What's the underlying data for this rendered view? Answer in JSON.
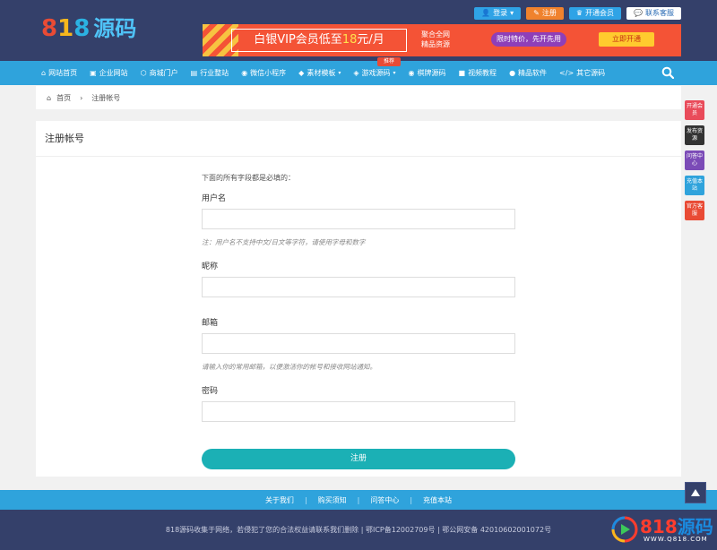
{
  "header": {
    "logo": {
      "digit1": "8",
      "digit2": "1",
      "digit3": "8",
      "text": "源码"
    },
    "actions": {
      "login": "登录",
      "register": "注册",
      "vip": "开通会员",
      "service": "联系客服"
    },
    "banner": {
      "main_pre": "白银VIP会员低至",
      "main_hl": "18",
      "main_post": "元/月",
      "sub1": "聚合全网",
      "sub2": "精品资源",
      "pill": "限时特价，先开先用",
      "open": "立即开通"
    }
  },
  "nav": {
    "items": [
      {
        "label": "网站首页",
        "icon": "home-icon",
        "glyph": "⌂"
      },
      {
        "label": "企业网站",
        "icon": "building-icon",
        "glyph": "▣"
      },
      {
        "label": "商城门户",
        "icon": "shop-icon",
        "glyph": "⬡"
      },
      {
        "label": "行业整站",
        "icon": "grid-icon",
        "glyph": "▤"
      },
      {
        "label": "微信小程序",
        "icon": "wechat-icon",
        "glyph": "◉"
      },
      {
        "label": "素材模板",
        "icon": "tag-icon",
        "glyph": "◆",
        "caret": true
      },
      {
        "label": "游戏源码",
        "icon": "diamond-icon",
        "glyph": "◈",
        "caret": true
      },
      {
        "label": "棋牌源码",
        "icon": "chess-icon",
        "glyph": "◉"
      },
      {
        "label": "视频教程",
        "icon": "video-icon",
        "glyph": "■"
      },
      {
        "label": "精品软件",
        "icon": "star-icon",
        "glyph": "●"
      },
      {
        "label": "其它源码",
        "icon": "code-icon",
        "glyph": "</>"
      }
    ],
    "recommend_badge": "推荐"
  },
  "breadcrumb": {
    "home": "首页",
    "sep": "›",
    "current": "注册帐号"
  },
  "card": {
    "title": "注册帐号",
    "note": "下面的所有字段都是必填的：",
    "fields": {
      "username": {
        "label": "用户名",
        "hint": "注：用户名不支持中文/日文等字符，请使用字母和数字"
      },
      "nickname": {
        "label": "昵称"
      },
      "email": {
        "label": "邮箱",
        "hint": "请输入你的常用邮箱，以便激活你的帐号和接收网站通知。"
      },
      "password": {
        "label": "密码"
      }
    },
    "submit": "注册"
  },
  "float_buttons": [
    {
      "label": "开通会员",
      "color": "#e94b5a"
    },
    {
      "label": "发布资源",
      "color": "#333333"
    },
    {
      "label": "问答中心",
      "color": "#7b4bb7"
    },
    {
      "label": "充值本站",
      "color": "#2fa3dc"
    },
    {
      "label": "官方客服",
      "color": "#e94b35"
    }
  ],
  "footer": {
    "links": [
      "关于我们",
      "购买须知",
      "问答中心",
      "充值本站"
    ],
    "copyright": "818源码收集于网络，若侵犯了您的合法权益请联系我们删除",
    "icp": "鄂ICP备12002709号",
    "police": "鄂公网安备 42010602001072号"
  },
  "watermark": {
    "num": "818",
    "cn": "源码",
    "url": "WWW.Q818.COM"
  }
}
